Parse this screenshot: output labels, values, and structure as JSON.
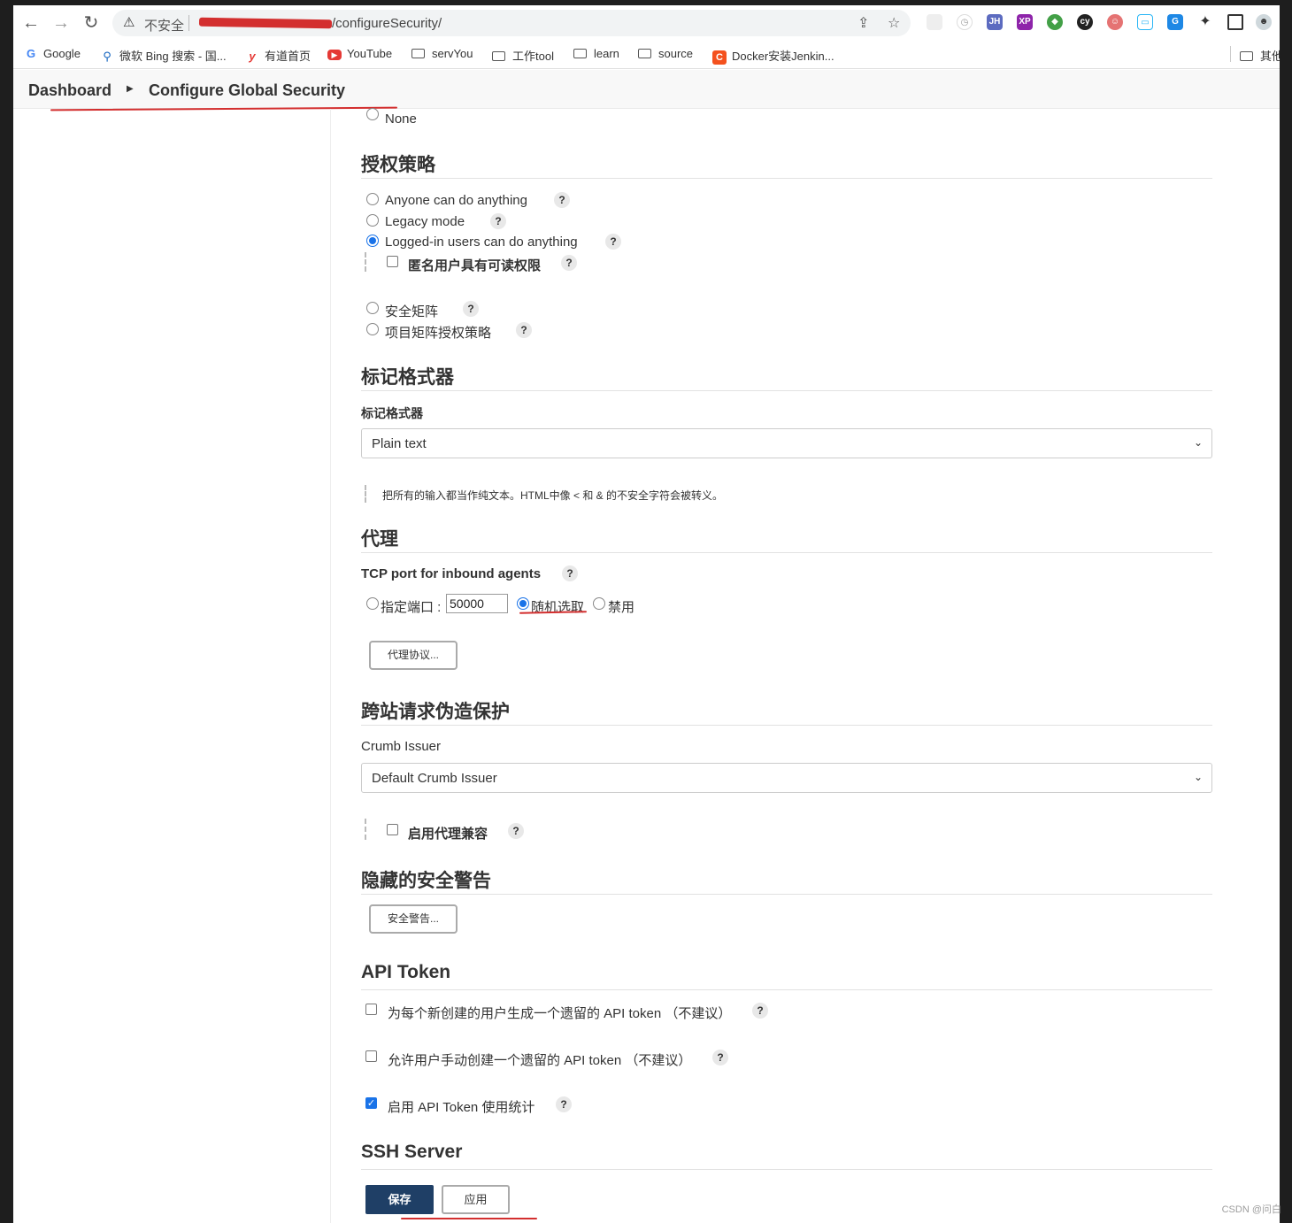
{
  "browser": {
    "insecure_label": "不安全",
    "url": "/configureSecurity/",
    "bookmarks": [
      {
        "label": "Google",
        "icon": "google-icon"
      },
      {
        "label": "微软 Bing 搜索 - 国...",
        "icon": "search-icon"
      },
      {
        "label": "有道首页",
        "icon": "youdao-icon"
      },
      {
        "label": "YouTube",
        "icon": "youtube-icon"
      },
      {
        "label": "servYou",
        "icon": "folder-icon"
      },
      {
        "label": "工作tool",
        "icon": "folder-icon"
      },
      {
        "label": "learn",
        "icon": "folder-icon"
      },
      {
        "label": "source",
        "icon": "folder-icon"
      },
      {
        "label": "Docker安装Jenkin...",
        "icon": "csdn-icon"
      },
      {
        "label": "其他",
        "icon": "folder-icon"
      }
    ]
  },
  "breadcrumb": {
    "home": "Dashboard",
    "current": "Configure Global Security"
  },
  "security_realm": {
    "none_option": "None"
  },
  "authorization": {
    "title": "授权策略",
    "options": [
      "Anyone can do anything",
      "Legacy mode",
      "Logged-in users can do anything",
      "安全矩阵",
      "项目矩阵授权策略"
    ],
    "anonymous_read": "匿名用户具有可读权限",
    "help": "?"
  },
  "markup": {
    "title": "标记格式器",
    "field_label": "标记格式器",
    "selected": "Plain text",
    "description": "把所有的输入都当作纯文本。HTML中像 < 和 & 的不安全字符会被转义。"
  },
  "agents": {
    "title": "代理",
    "tcp_label": "TCP port for inbound agents",
    "fixed_label": "指定端口 :",
    "port_value": "50000",
    "random_label": "随机选取",
    "disable_label": "禁用",
    "protocols_button": "代理协议..."
  },
  "csrf": {
    "title": "跨站请求伪造保护",
    "issuer_label": "Crumb Issuer",
    "issuer_selected": "Default Crumb Issuer",
    "proxy_compat": "启用代理兼容"
  },
  "hidden_warnings": {
    "title": "隐藏的安全警告",
    "button": "安全警告..."
  },
  "api_token": {
    "title": "API Token",
    "legacy_new_users": "为每个新创建的用户生成一个遗留的 API token （不建议）",
    "legacy_manual": "允许用户手动创建一个遗留的 API token （不建议）",
    "usage_stats": "启用 API Token 使用统计"
  },
  "ssh": {
    "title": "SSH Server"
  },
  "footer": {
    "save": "保存",
    "apply": "应用",
    "watermark": "CSDN @问白"
  },
  "colors": {
    "primary_button": "#1f3f66",
    "annotation_red": "#d32f2f",
    "radio_blue": "#1a73e8"
  }
}
